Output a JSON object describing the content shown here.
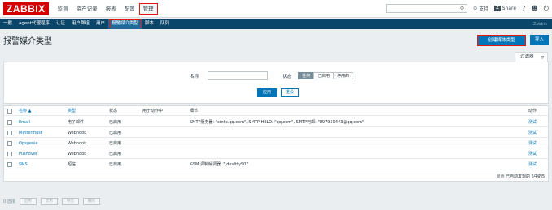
{
  "header": {
    "logo": "ZABBIX",
    "nav": [
      "监测",
      "资产记录",
      "报表",
      "配置",
      "管理"
    ],
    "nav_active_index": 4,
    "support": "支持",
    "share": "Share",
    "help": "?",
    "user_icon": "user-icon",
    "logout_icon": "power-icon"
  },
  "subnav": {
    "items": [
      "一般",
      "agent代理程序",
      "认证",
      "用户群组",
      "用户",
      "报警媒介类型",
      "脚本",
      "队列"
    ],
    "active_index": 5,
    "right_label": "Zabbix"
  },
  "page": {
    "title": "报警媒介类型",
    "create_button": "创建媒体类型",
    "import_button": "导入"
  },
  "filter": {
    "tab_label": "过滤器",
    "name_label": "名称",
    "name_value": "",
    "status_label": "状态",
    "status_options": [
      "任何",
      "已启用",
      "停用的"
    ],
    "status_selected_index": 0,
    "apply_button": "应用",
    "reset_button": "重设"
  },
  "table": {
    "headers": {
      "name": "名称 ▲",
      "type": "类型",
      "status": "状态",
      "used_in_actions": "用于动作中",
      "details": "细节",
      "actions": "动作"
    },
    "rows": [
      {
        "name": "Email",
        "type": "电子邮件",
        "status": "已启用",
        "used": "",
        "details": "SMTP服务器: \"smtp.qq.com\", SMTP HELO: \"qq.com\", SMTP电邮: \"897959443@qq.com\"",
        "action": "测试"
      },
      {
        "name": "Mattermost",
        "type": "Webhook",
        "status": "已启用",
        "used": "",
        "details": "",
        "action": "测试"
      },
      {
        "name": "Opsgenie",
        "type": "Webhook",
        "status": "已启用",
        "used": "",
        "details": "",
        "action": "测试"
      },
      {
        "name": "Pushover",
        "type": "Webhook",
        "status": "已启用",
        "used": "",
        "details": "",
        "action": "测试"
      },
      {
        "name": "SMS",
        "type": "短信",
        "status": "已启用",
        "used": "",
        "details": "GSM 调制解调器: \"/dev/ttyS0\"",
        "action": "测试"
      }
    ],
    "footer_info": "显示 已自动发现的 5中的5"
  },
  "bottom": {
    "selected": "0 选择",
    "buttons": [
      "启用",
      "禁用",
      "导出",
      "删除"
    ]
  },
  "colors": {
    "logo_red": "#d40000",
    "subnav_blue": "#0a466a",
    "primary_blue": "#0275b8",
    "highlight_red": "#e3170d",
    "enabled_green": "#1f2c33"
  }
}
